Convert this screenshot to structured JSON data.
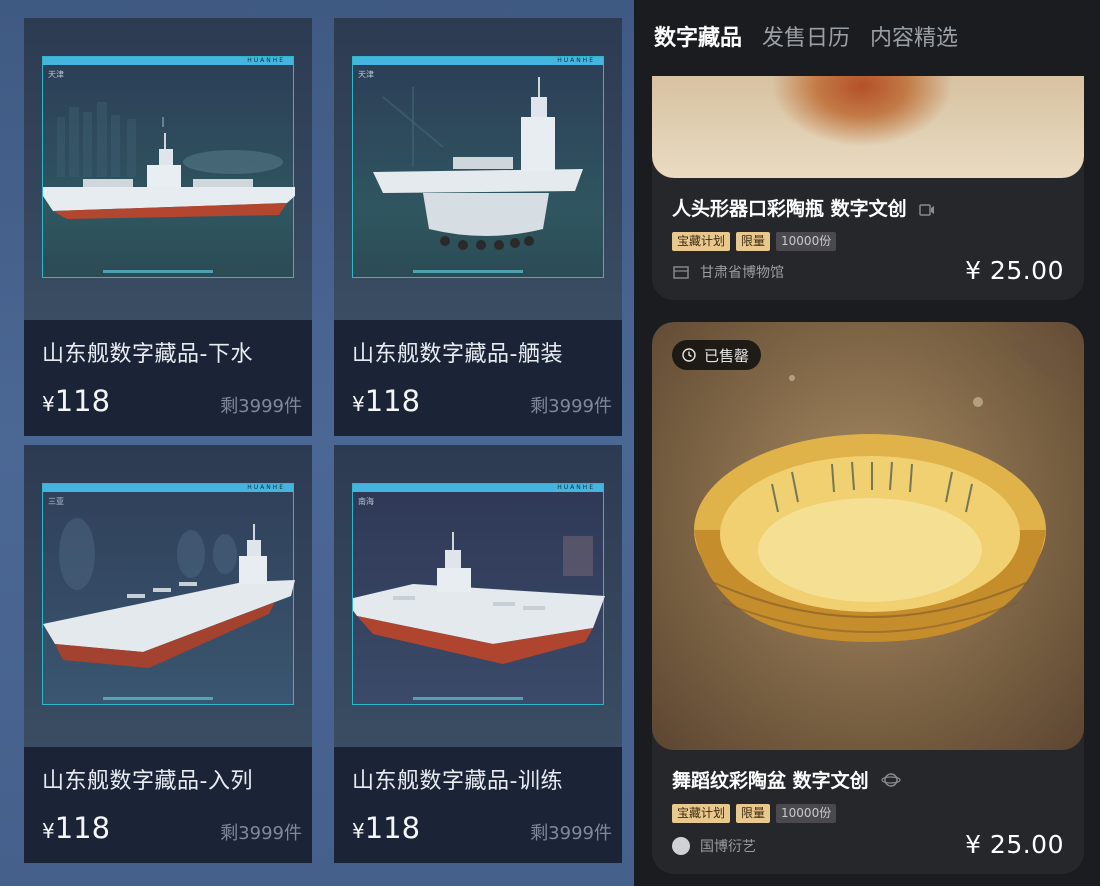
{
  "products": [
    {
      "title": "山东舰数字藏品-下水",
      "price": "118",
      "currency": "¥",
      "stock": "剩3999件",
      "frame_tag": "天津",
      "brand": "HUANHE"
    },
    {
      "title": "山东舰数字藏品-舾装",
      "price": "118",
      "currency": "¥",
      "stock": "剩3999件",
      "frame_tag": "天津",
      "brand": "HUANHE"
    },
    {
      "title": "山东舰数字藏品-入列",
      "price": "118",
      "currency": "¥",
      "stock": "剩3999件",
      "frame_tag": "三亚",
      "brand": "HUANHE"
    },
    {
      "title": "山东舰数字藏品-训练",
      "price": "118",
      "currency": "¥",
      "stock": "剩3999件",
      "frame_tag": "南海",
      "brand": "HUANHE"
    }
  ],
  "tabs": [
    {
      "label": "数字藏品",
      "active": true
    },
    {
      "label": "发售日历",
      "active": false
    },
    {
      "label": "内容精选",
      "active": false
    }
  ],
  "collectibles": [
    {
      "title": "人头形器口彩陶瓶 数字文创",
      "tags": [
        "宝藏计划",
        "限量",
        "10000份"
      ],
      "org": "甘肃省博物馆",
      "price": "¥ 25.00"
    },
    {
      "status": "已售罄",
      "title": "舞蹈纹彩陶盆 数字文创",
      "tags": [
        "宝藏计划",
        "限量",
        "10000份"
      ],
      "org": "国博衍艺",
      "price": "¥ 25.00"
    }
  ]
}
